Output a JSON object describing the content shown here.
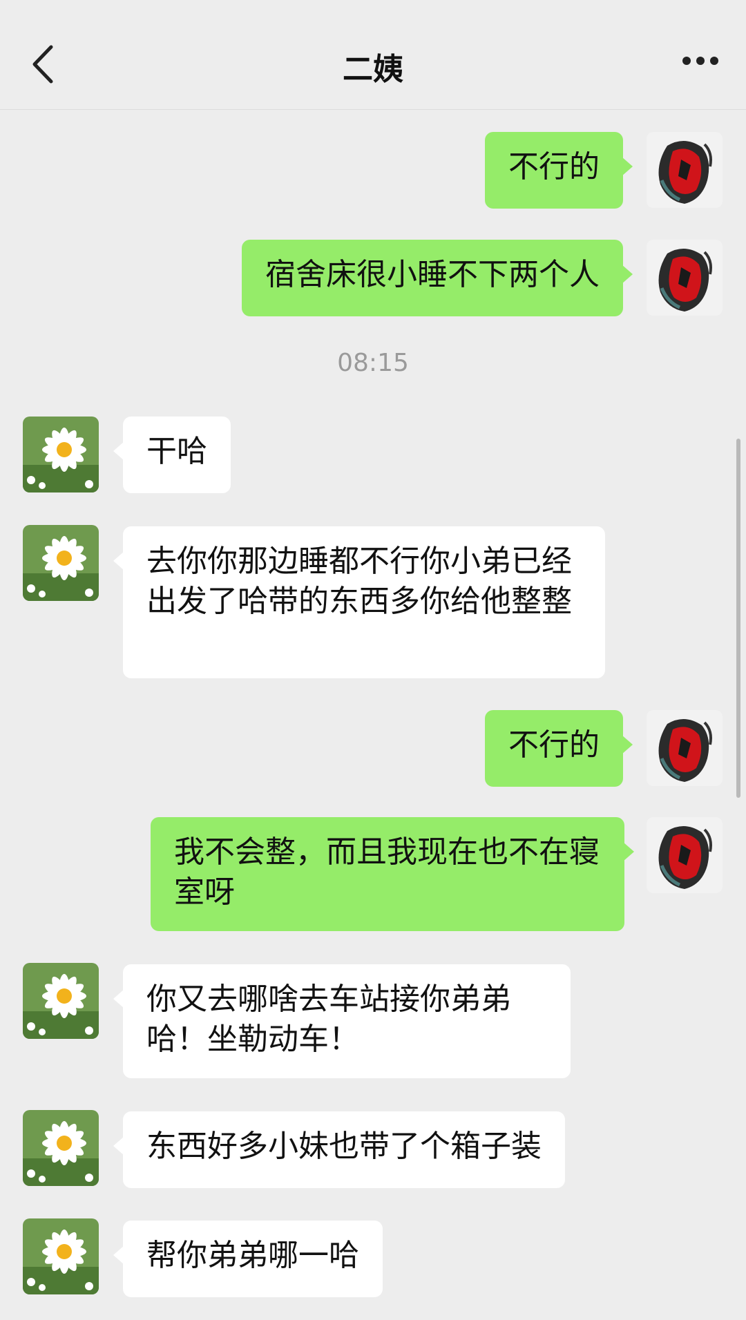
{
  "header": {
    "title": "二姨"
  },
  "messages": [
    {
      "text": "不行的"
    },
    {
      "text": "宿舍床很小睡不下两个人"
    },
    {
      "text": "干哈"
    },
    {
      "text": "去你你那边睡都不行你小弟已经出发了哈带的东西多你给他整整"
    },
    {
      "text": "不行的"
    },
    {
      "text": "我不会整，而且我现在也不在寝室呀"
    },
    {
      "text": "你又去哪啥去车站接你弟弟哈！坐勒动车！"
    },
    {
      "text": "东西好多小妹也带了个箱子装"
    },
    {
      "text": "帮你弟弟哪一哈"
    }
  ],
  "timestamp": "08:15",
  "colors": {
    "outgoing_bubble": "#95ec69",
    "incoming_bubble": "#ffffff",
    "background": "#ededed"
  }
}
